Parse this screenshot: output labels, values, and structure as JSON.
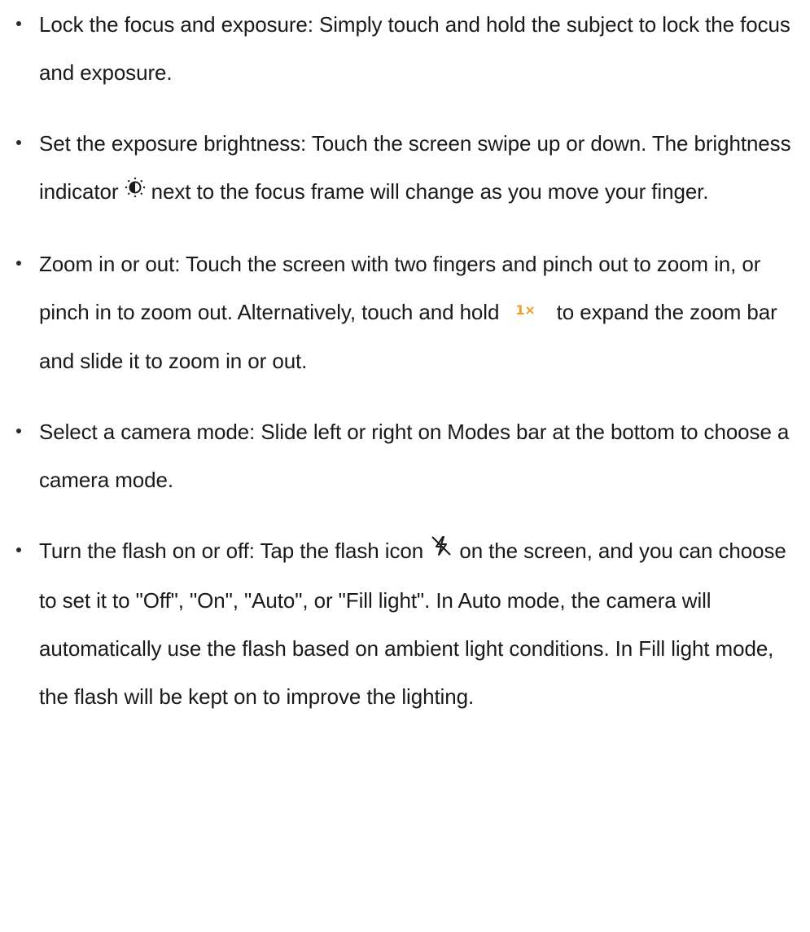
{
  "items": [
    {
      "text": "Lock the focus and exposure: Simply touch and hold the subject to lock the focus and exposure."
    },
    {
      "before": "Set the exposure brightness: Touch the screen swipe up or down. The brightness indicator",
      "icon": "brightness-icon",
      "after": "next to the focus frame will change as you move your finger."
    },
    {
      "before": "Zoom in or out: Touch the screen with two fingers and pinch out to zoom in, or pinch in to zoom out. Alternatively, touch and hold",
      "badge": "1×",
      "badge_color": "#f29b26",
      "after": "to expand the zoom bar and slide it to zoom in or out."
    },
    {
      "text": "Select a camera mode: Slide left or right on Modes bar at the bottom to choose a camera mode."
    },
    {
      "before": "Turn the flash on or off: Tap the flash icon",
      "icon": "flash-off-icon",
      "after": "on the screen, and you can choose to set it to \"Off\", \"On\", \"Auto\", or \"Fill light\". In Auto mode, the camera will automatically use the flash based on ambient light conditions. In Fill light mode, the flash will be kept on to improve the lighting."
    }
  ]
}
